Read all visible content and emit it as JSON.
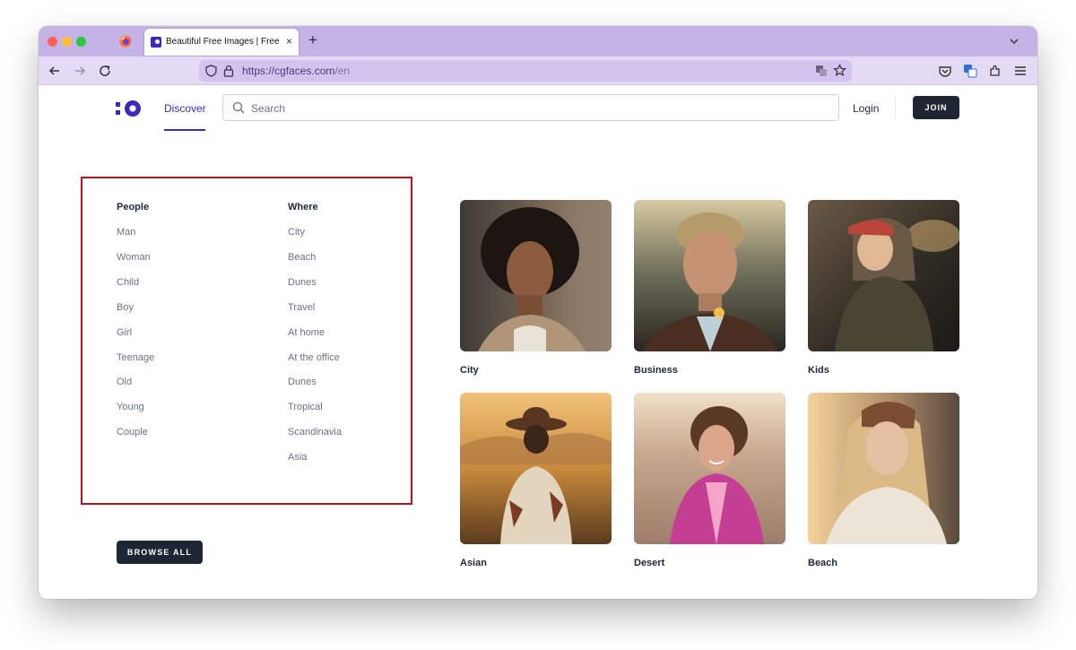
{
  "browser": {
    "tab_title": "Beautiful Free Images | Free Pro",
    "url_host": "https://cgfaces.com",
    "url_path": "/en",
    "new_tab_symbol": "+",
    "close_symbol": "×"
  },
  "header": {
    "nav_discover": "Discover",
    "search_placeholder": "Search",
    "login": "Login",
    "join": "JOIN"
  },
  "categories": {
    "people": {
      "heading": "People",
      "items": [
        "Man",
        "Woman",
        "Child",
        "Boy",
        "Girl",
        "Teenage",
        "Old",
        "Young",
        "Couple"
      ]
    },
    "where": {
      "heading": "Where",
      "items": [
        "City",
        "Beach",
        "Dunes",
        "Travel",
        "At home",
        "At the office",
        "Dunes",
        "Tropical",
        "Scandinavia",
        "Asia"
      ]
    }
  },
  "browse_all": "BROWSE ALL",
  "gallery": [
    {
      "label": "City"
    },
    {
      "label": "Business"
    },
    {
      "label": "Kids"
    },
    {
      "label": "Asian"
    },
    {
      "label": "Desert"
    },
    {
      "label": "Beach"
    }
  ],
  "colors": {
    "brand": "#3b2bbd",
    "dark_button": "#1e2633",
    "highlight_border": "#c8101a",
    "tab_strip": "#c4b3e6"
  }
}
